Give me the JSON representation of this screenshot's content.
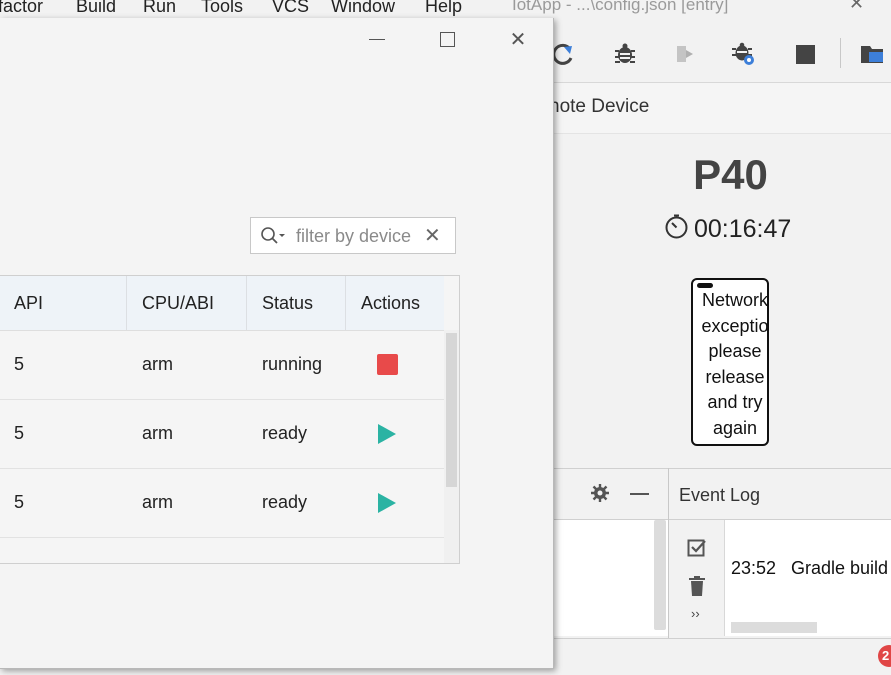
{
  "menubar": {
    "items": [
      "factor",
      "Build",
      "Run",
      "Tools",
      "VCS",
      "Window",
      "Help"
    ],
    "window_title": "IotApp - ...\\config.json [entry]"
  },
  "toolbar": {
    "icons": [
      "rerun-icon",
      "debug-icon",
      "attach-debugger-icon",
      "debug-settings-icon",
      "stop-icon",
      "project-structure-icon"
    ]
  },
  "remote_device": {
    "title": "note Device",
    "device_name": "P40",
    "timer": "00:16:47",
    "screen_message_lines": [
      "Network",
      "exceptio",
      "please",
      "release",
      "and try",
      "again"
    ]
  },
  "dialog": {
    "filter_placeholder": "filter by device",
    "table": {
      "columns": [
        "API",
        "CPU/ABI",
        "Status",
        "Actions"
      ],
      "rows": [
        {
          "api": "5",
          "cpu": "arm",
          "status": "running",
          "action": "stop"
        },
        {
          "api": "5",
          "cpu": "arm",
          "status": "ready",
          "action": "run"
        },
        {
          "api": "5",
          "cpu": "arm",
          "status": "ready",
          "action": "run"
        }
      ]
    }
  },
  "event_log": {
    "title": "Event Log",
    "entries": [
      {
        "time": "23:52",
        "message": "Gradle build"
      }
    ]
  },
  "statusbar": {
    "badge": "2"
  },
  "colors": {
    "stop": "#e84a4a",
    "run": "#2bb3a3",
    "badge": "#e04646"
  }
}
